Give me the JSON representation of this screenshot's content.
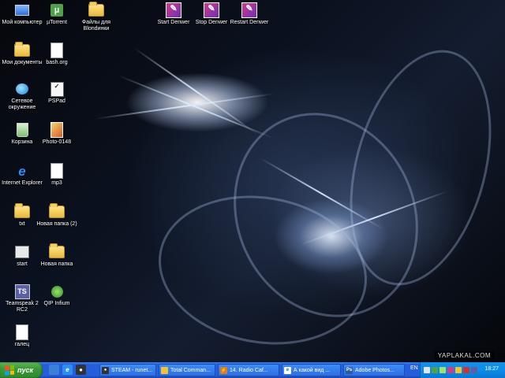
{
  "desktop": {
    "icons": [
      {
        "id": "moi-kompyuter",
        "label": "Мой компьютер",
        "kind": "computer"
      },
      {
        "id": "utorrent",
        "label": "µTorrent",
        "kind": "app"
      },
      {
        "id": "fayly-dlya-blondinki",
        "label": "Файлы для Blondинки",
        "kind": "folder"
      },
      {
        "id": "start-denwer",
        "label": "Start Denwer",
        "kind": "denwer"
      },
      {
        "id": "stop-denwer",
        "label": "Stop Denwer",
        "kind": "denwer"
      },
      {
        "id": "restart-denwer",
        "label": "Restart Denwer",
        "kind": "denwer"
      },
      {
        "id": "moi-dokumenty",
        "label": "Мои документы",
        "kind": "folder"
      },
      {
        "id": "bash-org",
        "label": "bash.org",
        "kind": "doc"
      },
      {
        "id": "setevoe-okruzhenie",
        "label": "Сетевое окружение",
        "kind": "network"
      },
      {
        "id": "pspad",
        "label": "PSPad",
        "kind": "app"
      },
      {
        "id": "korzina",
        "label": "Корзина",
        "kind": "recycle"
      },
      {
        "id": "photo-0148",
        "label": "Photo-0148",
        "kind": "image"
      },
      {
        "id": "internet-explorer",
        "label": "Internet Explorer",
        "kind": "ie"
      },
      {
        "id": "mp3",
        "label": "mp3",
        "kind": "doc"
      },
      {
        "id": "txt",
        "label": "txt",
        "kind": "folder"
      },
      {
        "id": "novaya-papka-2",
        "label": "Новая папка (2)",
        "kind": "folder"
      },
      {
        "id": "start",
        "label": "start",
        "kind": "app"
      },
      {
        "id": "novaya-papka",
        "label": "Новая папка",
        "kind": "folder"
      },
      {
        "id": "teamspeak",
        "label": "Teamspeak 2 RC2",
        "kind": "app"
      },
      {
        "id": "qip-infium",
        "label": "QIP Infium",
        "kind": "app"
      },
      {
        "id": "galets",
        "label": "галец",
        "kind": "doc"
      }
    ]
  },
  "watermark": "YAPLAKAL.COM",
  "taskbar": {
    "start_label": "пуск",
    "tasks": [
      {
        "label": "STEAM - runet...",
        "icon": "steam-icon",
        "color": "#333333"
      },
      {
        "label": "Total Comman...",
        "icon": "total-commander-icon",
        "color": "#f2c230"
      },
      {
        "label": "14. Radio Caf...",
        "icon": "winamp-icon",
        "color": "#e07b1a"
      },
      {
        "label": "А какой вид ...",
        "icon": "ie-icon",
        "color": "#1e6fd9"
      },
      {
        "label": "Adobe Photos...",
        "icon": "photoshop-icon",
        "color": "#2b5c9e"
      }
    ],
    "language": "EN",
    "clock": "18:27"
  }
}
